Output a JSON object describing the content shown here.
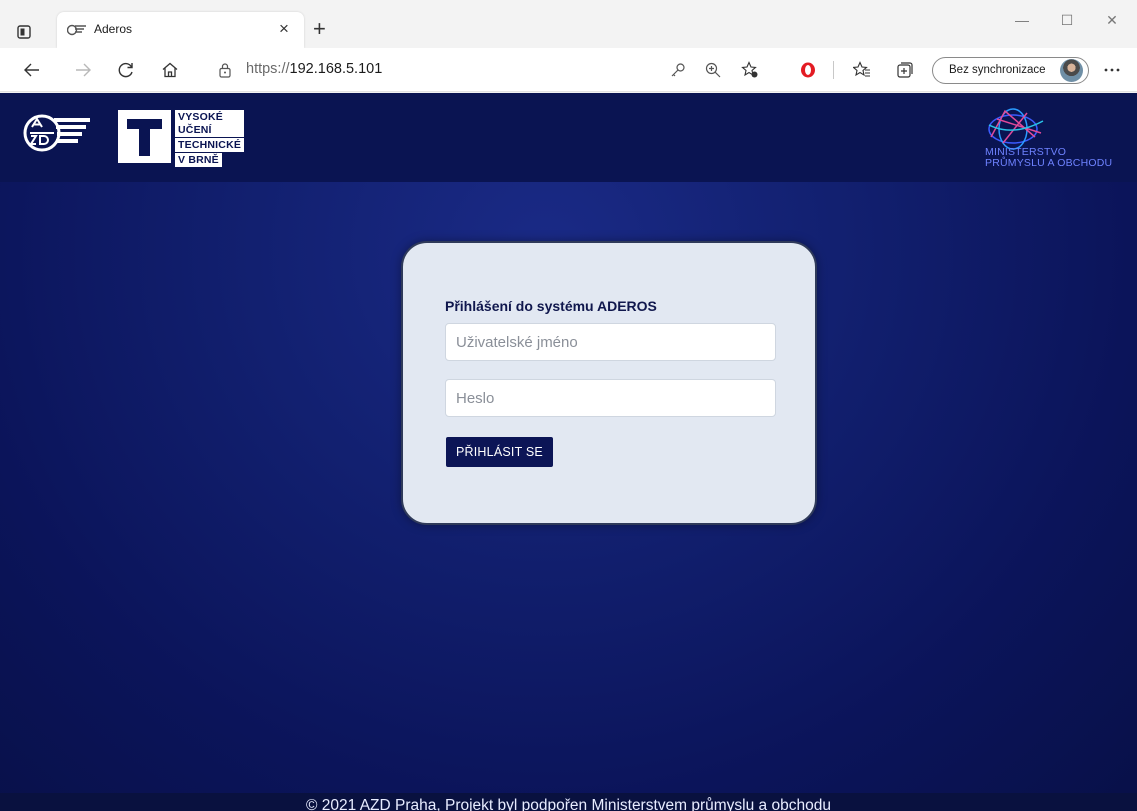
{
  "browser": {
    "tab": {
      "title": "Aderos"
    },
    "address": {
      "scheme": "https://",
      "host": "192.168.5.101"
    },
    "sync_button_label": "Bez synchronizace",
    "window_controls": {
      "minimize": "—",
      "maximize": "☐",
      "close": "✕"
    }
  },
  "header": {
    "vut_lines": [
      "VYSOKÉ UČENÍ",
      "TECHNICKÉ",
      "V BRNĚ"
    ],
    "mpo_lines": [
      "MINISTERSTVO",
      "PRŮMYSLU A OBCHODU"
    ]
  },
  "login": {
    "title": "Přihlášení do systému ADEROS",
    "username_placeholder": "Uživatelské jméno",
    "username_value": "",
    "password_placeholder": "Heslo",
    "password_value": "",
    "submit_label": "PŘIHLÁSIT SE"
  },
  "footer": {
    "text": "© 2021 AZD Praha, Projekt byl podpořen Ministerstvem průmyslu a obchodu"
  },
  "icons": {
    "tab_actions": "tab-actions-icon",
    "favicon": "azd-favicon-icon",
    "back": "back-arrow-icon",
    "forward": "forward-arrow-icon",
    "refresh": "refresh-icon",
    "home": "home-icon",
    "lock": "lock-icon",
    "key": "key-icon",
    "zoom": "zoom-icon",
    "favorite": "add-favorite-icon",
    "opera": "opera-icon",
    "favorites": "favorites-icon",
    "collections": "collections-icon",
    "more": "more-icon"
  },
  "colors": {
    "page_bg": "#0b145a",
    "header_bg": "#0a1452",
    "card_bg": "#e2e8f2",
    "button_bg": "#0c1556",
    "title_text": "#10174d",
    "mpo_text": "#6e82ff"
  }
}
